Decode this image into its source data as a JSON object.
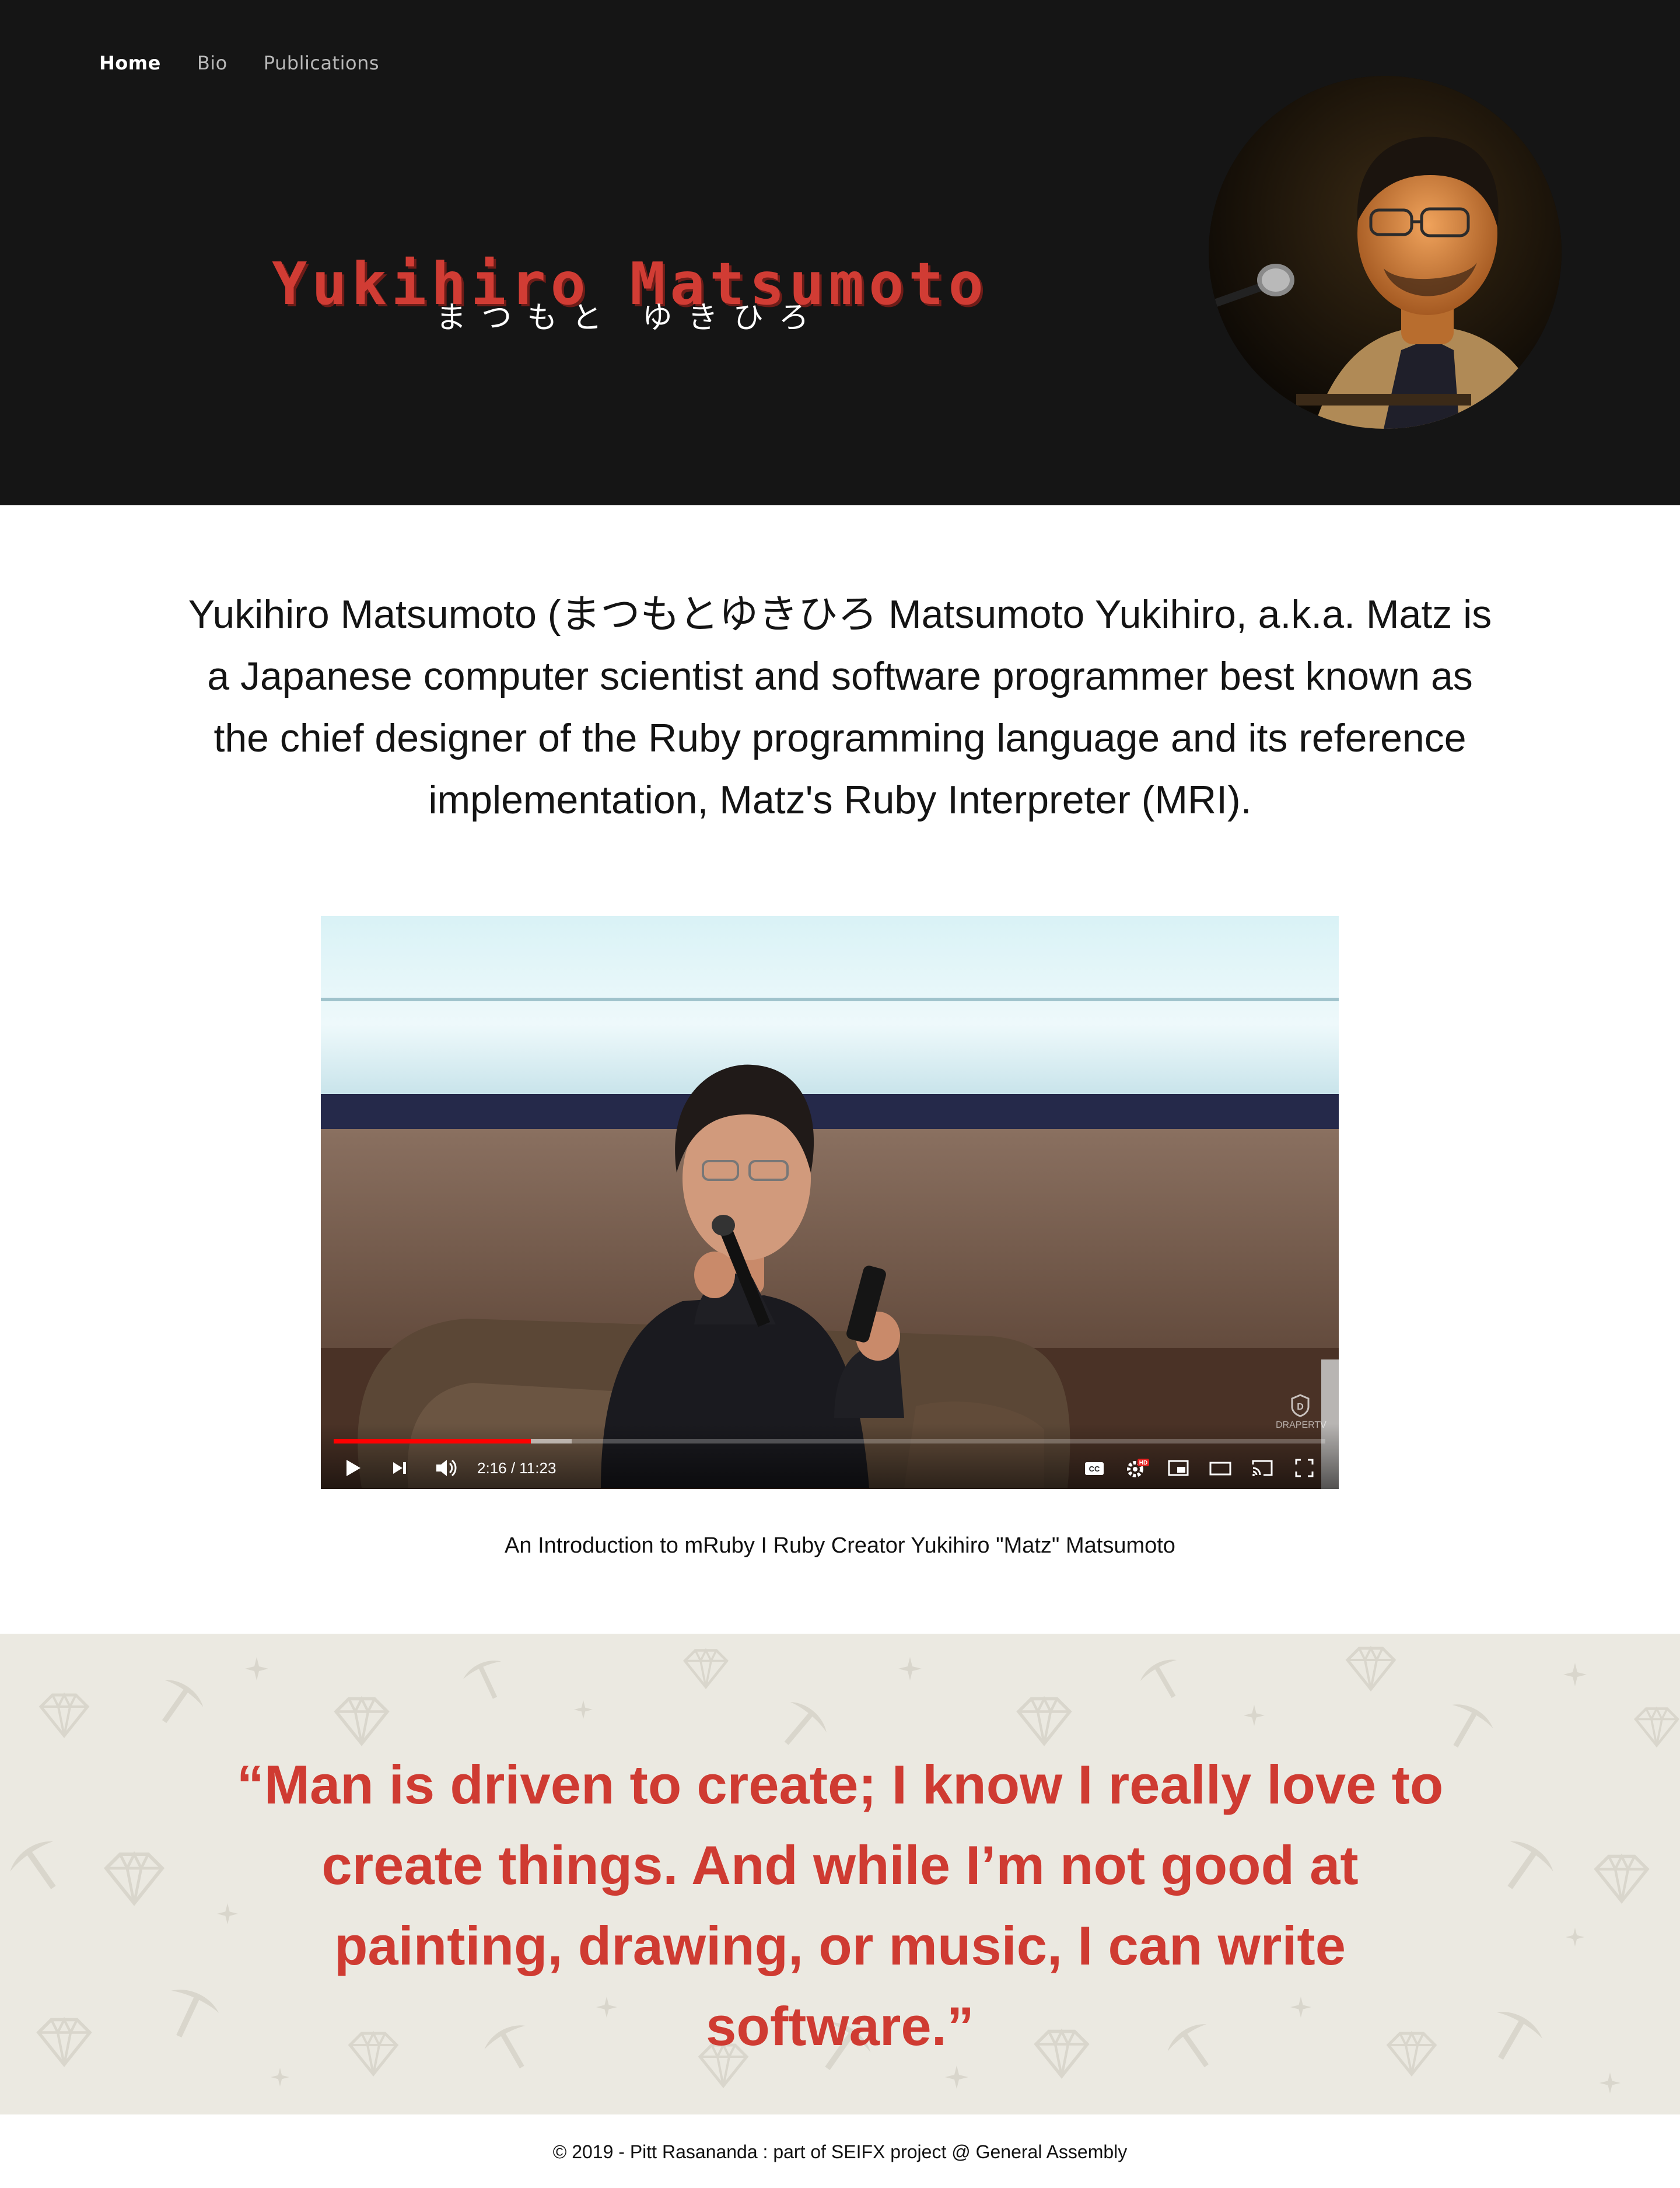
{
  "nav": {
    "items": [
      {
        "label": "Home",
        "active": true
      },
      {
        "label": "Bio",
        "active": false
      },
      {
        "label": "Publications",
        "active": false
      }
    ]
  },
  "hero": {
    "title": "Yukihiro Matsumoto",
    "subtitle": "まつもと ゆきひろ",
    "accent_color": "#d13c34"
  },
  "intro": {
    "text": "Yukihiro Matsumoto (まつもとゆきひろ Matsumoto Yukihiro, a.k.a. Matz is a Japanese computer scientist and software programmer best known as the chief designer of the Ruby programming language and its reference implementation, Matz's Ruby Interpreter (MRI)."
  },
  "video": {
    "time_display": "2:16 / 11:23",
    "progress_played": 0.199,
    "progress_buffered": 0.24,
    "watermark": "DRAPERTV",
    "controls": [
      "play-icon",
      "next-icon",
      "volume-icon",
      "captions-icon",
      "settings-icon",
      "miniplayer-icon",
      "theater-icon",
      "cast-icon",
      "fullscreen-icon"
    ],
    "settings_badge": "HD",
    "captions_label": "CC",
    "caption": "An Introduction to mRuby I Ruby Creator Yukihiro \"Matz\" Matsumoto"
  },
  "quote": {
    "text": "“Man is driven to create; I know I really love to create things. And while I’m not good at painting, drawing, or music, I can write software.”",
    "color": "#cf3b32",
    "background": "#ebe9e1"
  },
  "footer": {
    "text": "© 2019 - Pitt Rasananda : part of SEIFX project @ General Assembly"
  }
}
